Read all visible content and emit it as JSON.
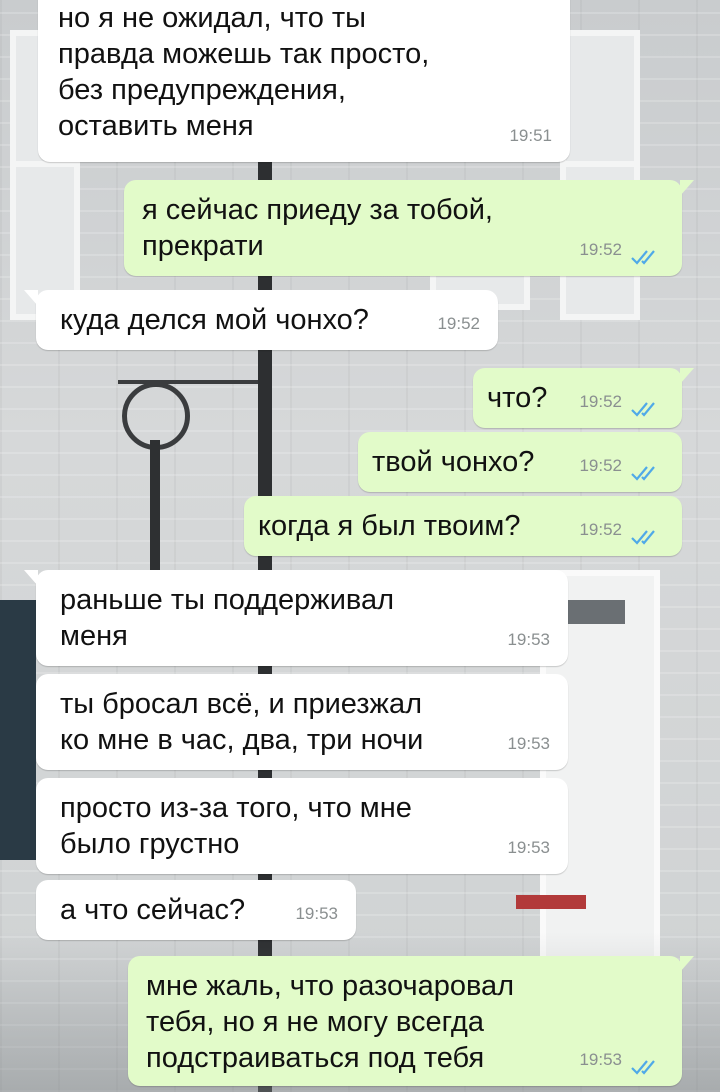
{
  "colors": {
    "incoming_bubble": "#ffffff",
    "outgoing_bubble": "#e2fbc9",
    "time_text": "#8a8f90",
    "read_ticks": "#4fa9e8"
  },
  "messages": [
    {
      "direction": "in",
      "text": "но я не ожидал, что ты\nправда можешь так просто,\nбез предупреждения,\nоставить меня",
      "time": "19:51"
    },
    {
      "direction": "out",
      "text": "я сейчас приеду за тобой,\nпрекрати",
      "time": "19:52",
      "status_icon": "double-check-read-icon"
    },
    {
      "direction": "in",
      "text": "куда делся мой чонхо?",
      "time": "19:52"
    },
    {
      "direction": "out",
      "text": "что?",
      "time": "19:52",
      "status_icon": "double-check-read-icon"
    },
    {
      "direction": "out",
      "text": "твой чонхо?",
      "time": "19:52",
      "status_icon": "double-check-read-icon"
    },
    {
      "direction": "out",
      "text": "когда я был твоим?",
      "time": "19:52",
      "status_icon": "double-check-read-icon"
    },
    {
      "direction": "in",
      "text": "раньше ты поддерживал\nменя",
      "time": "19:53"
    },
    {
      "direction": "in",
      "text": "ты бросал всё, и приезжал\nко мне в час, два, три ночи",
      "time": "19:53"
    },
    {
      "direction": "in",
      "text": "просто из-за того, что мне\nбыло грустно",
      "time": "19:53"
    },
    {
      "direction": "in",
      "text": "а что сейчас?",
      "time": "19:53"
    },
    {
      "direction": "out",
      "text": "мне жаль, что разочаровал\nтебя, но я не могу всегда\nподстраиваться под тебя",
      "time": "19:53",
      "status_icon": "double-check-read-icon"
    }
  ]
}
